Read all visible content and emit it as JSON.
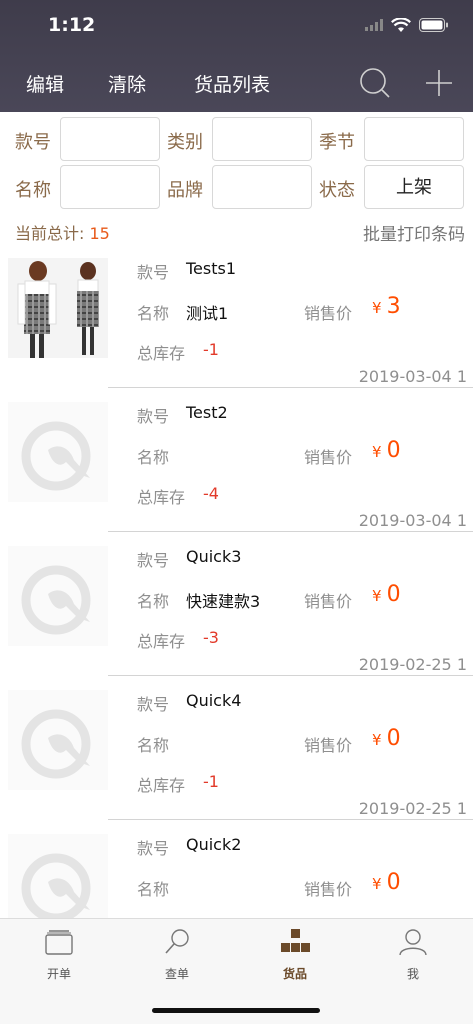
{
  "status": {
    "time": "1:12"
  },
  "nav": {
    "edit": "编辑",
    "clear": "清除",
    "title": "货品列表"
  },
  "filters": {
    "style_no": "款号",
    "category": "类别",
    "season": "季节",
    "name": "名称",
    "brand": "品牌",
    "status": "状态",
    "status_value": "上架"
  },
  "summary": {
    "label": "当前总计:",
    "count": "15",
    "print": "批量打印条码"
  },
  "labels": {
    "style_no": "款号",
    "name": "名称",
    "price": "销售价",
    "stock": "总库存",
    "currency": "¥"
  },
  "items": [
    {
      "style_no": "Tests1",
      "name": "测试1",
      "price": "3",
      "stock": "-1",
      "date": "2019-03-04 1"
    },
    {
      "style_no": "Test2",
      "name": "",
      "price": "0",
      "stock": "-4",
      "date": "2019-03-04 1"
    },
    {
      "style_no": "Quick3",
      "name": "快速建款3",
      "price": "0",
      "stock": "-3",
      "date": "2019-02-25 1"
    },
    {
      "style_no": "Quick4",
      "name": "",
      "price": "0",
      "stock": "-1",
      "date": "2019-02-25 1"
    },
    {
      "style_no": "Quick2",
      "name": "",
      "price": "0",
      "stock": "",
      "date": ""
    }
  ],
  "tabs": [
    {
      "label": "开单",
      "icon": "folder-icon"
    },
    {
      "label": "查单",
      "icon": "search-icon"
    },
    {
      "label": "货品",
      "icon": "boxes-icon"
    },
    {
      "label": "我",
      "icon": "user-icon"
    }
  ],
  "colors": {
    "header": "#45424f",
    "accent": "#ff4d00",
    "label": "#8a6a4a",
    "stock": "#e23a2a"
  }
}
